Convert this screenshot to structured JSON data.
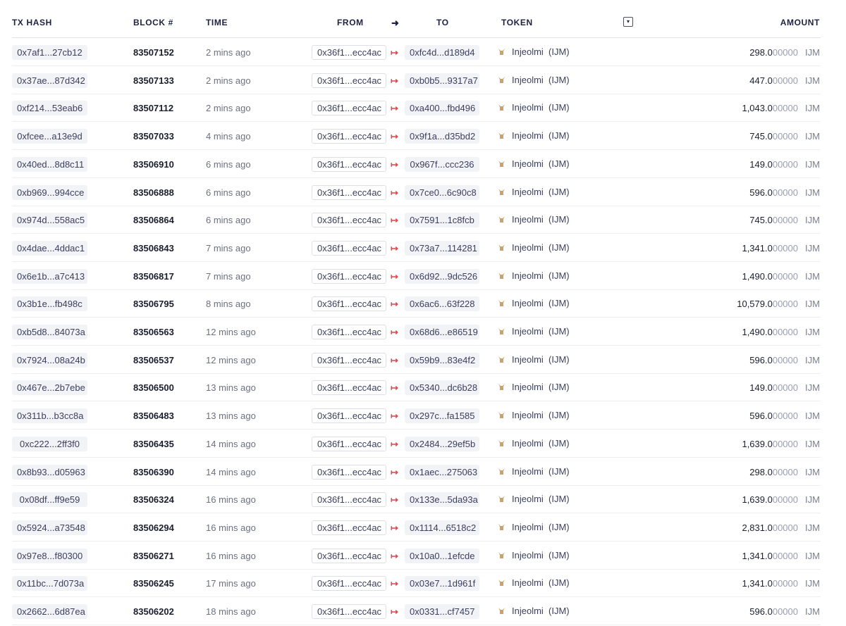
{
  "header": {
    "tx_hash": "TX HASH",
    "block": "BLOCK #",
    "time": "TIME",
    "from": "FROM",
    "arrow": "➜",
    "to": "TO",
    "token": "TOKEN",
    "filter_icon": "▾",
    "amount": "AMOUNT"
  },
  "icons": {
    "direction": "arrow-right-out-icon",
    "token": "injeolmi-token-icon",
    "filter": "filter-dropdown-icon"
  },
  "colors": {
    "direction_arrow": "#e0474c",
    "chip_bg": "#f2f3f7",
    "header_text": "#1e2240"
  },
  "rows": [
    {
      "tx": "0x7af1...27cb12",
      "block": "83507152",
      "time": "2 mins ago",
      "from": "0x36f1...ecc4ac",
      "to": "0xfc4d...d189d4",
      "token": "Injeolmi",
      "symbol": "(IJM)",
      "amount_int": "298.0",
      "amount_dec": "00000",
      "unit": "IJM"
    },
    {
      "tx": "0x37ae...87d342",
      "block": "83507133",
      "time": "2 mins ago",
      "from": "0x36f1...ecc4ac",
      "to": "0xb0b5...9317a7",
      "token": "Injeolmi",
      "symbol": "(IJM)",
      "amount_int": "447.0",
      "amount_dec": "00000",
      "unit": "IJM"
    },
    {
      "tx": "0xf214...53eab6",
      "block": "83507112",
      "time": "2 mins ago",
      "from": "0x36f1...ecc4ac",
      "to": "0xa400...fbd496",
      "token": "Injeolmi",
      "symbol": "(IJM)",
      "amount_int": "1,043.0",
      "amount_dec": "00000",
      "unit": "IJM"
    },
    {
      "tx": "0xfcee...a13e9d",
      "block": "83507033",
      "time": "4 mins ago",
      "from": "0x36f1...ecc4ac",
      "to": "0x9f1a...d35bd2",
      "token": "Injeolmi",
      "symbol": "(IJM)",
      "amount_int": "745.0",
      "amount_dec": "00000",
      "unit": "IJM"
    },
    {
      "tx": "0x40ed...8d8c11",
      "block": "83506910",
      "time": "6 mins ago",
      "from": "0x36f1...ecc4ac",
      "to": "0x967f...ccc236",
      "token": "Injeolmi",
      "symbol": "(IJM)",
      "amount_int": "149.0",
      "amount_dec": "00000",
      "unit": "IJM"
    },
    {
      "tx": "0xb969...994cce",
      "block": "83506888",
      "time": "6 mins ago",
      "from": "0x36f1...ecc4ac",
      "to": "0x7ce0...6c90c8",
      "token": "Injeolmi",
      "symbol": "(IJM)",
      "amount_int": "596.0",
      "amount_dec": "00000",
      "unit": "IJM"
    },
    {
      "tx": "0x974d...558ac5",
      "block": "83506864",
      "time": "6 mins ago",
      "from": "0x36f1...ecc4ac",
      "to": "0x7591...1c8fcb",
      "token": "Injeolmi",
      "symbol": "(IJM)",
      "amount_int": "745.0",
      "amount_dec": "00000",
      "unit": "IJM"
    },
    {
      "tx": "0x4dae...4ddac1",
      "block": "83506843",
      "time": "7 mins ago",
      "from": "0x36f1...ecc4ac",
      "to": "0x73a7...114281",
      "token": "Injeolmi",
      "symbol": "(IJM)",
      "amount_int": "1,341.0",
      "amount_dec": "00000",
      "unit": "IJM"
    },
    {
      "tx": "0x6e1b...a7c413",
      "block": "83506817",
      "time": "7 mins ago",
      "from": "0x36f1...ecc4ac",
      "to": "0x6d92...9dc526",
      "token": "Injeolmi",
      "symbol": "(IJM)",
      "amount_int": "1,490.0",
      "amount_dec": "00000",
      "unit": "IJM"
    },
    {
      "tx": "0x3b1e...fb498c",
      "block": "83506795",
      "time": "8 mins ago",
      "from": "0x36f1...ecc4ac",
      "to": "0x6ac6...63f228",
      "token": "Injeolmi",
      "symbol": "(IJM)",
      "amount_int": "10,579.0",
      "amount_dec": "00000",
      "unit": "IJM"
    },
    {
      "tx": "0xb5d8...84073a",
      "block": "83506563",
      "time": "12 mins ago",
      "from": "0x36f1...ecc4ac",
      "to": "0x68d6...e86519",
      "token": "Injeolmi",
      "symbol": "(IJM)",
      "amount_int": "1,490.0",
      "amount_dec": "00000",
      "unit": "IJM"
    },
    {
      "tx": "0x7924...08a24b",
      "block": "83506537",
      "time": "12 mins ago",
      "from": "0x36f1...ecc4ac",
      "to": "0x59b9...83e4f2",
      "token": "Injeolmi",
      "symbol": "(IJM)",
      "amount_int": "596.0",
      "amount_dec": "00000",
      "unit": "IJM"
    },
    {
      "tx": "0x467e...2b7ebe",
      "block": "83506500",
      "time": "13 mins ago",
      "from": "0x36f1...ecc4ac",
      "to": "0x5340...dc6b28",
      "token": "Injeolmi",
      "symbol": "(IJM)",
      "amount_int": "149.0",
      "amount_dec": "00000",
      "unit": "IJM"
    },
    {
      "tx": "0x311b...b3cc8a",
      "block": "83506483",
      "time": "13 mins ago",
      "from": "0x36f1...ecc4ac",
      "to": "0x297c...fa1585",
      "token": "Injeolmi",
      "symbol": "(IJM)",
      "amount_int": "596.0",
      "amount_dec": "00000",
      "unit": "IJM"
    },
    {
      "tx": "0xc222...2ff3f0",
      "block": "83506435",
      "time": "14 mins ago",
      "from": "0x36f1...ecc4ac",
      "to": "0x2484...29ef5b",
      "token": "Injeolmi",
      "symbol": "(IJM)",
      "amount_int": "1,639.0",
      "amount_dec": "00000",
      "unit": "IJM"
    },
    {
      "tx": "0x8b93...d05963",
      "block": "83506390",
      "time": "14 mins ago",
      "from": "0x36f1...ecc4ac",
      "to": "0x1aec...275063",
      "token": "Injeolmi",
      "symbol": "(IJM)",
      "amount_int": "298.0",
      "amount_dec": "00000",
      "unit": "IJM"
    },
    {
      "tx": "0x08df...ff9e59",
      "block": "83506324",
      "time": "16 mins ago",
      "from": "0x36f1...ecc4ac",
      "to": "0x133e...5da93a",
      "token": "Injeolmi",
      "symbol": "(IJM)",
      "amount_int": "1,639.0",
      "amount_dec": "00000",
      "unit": "IJM"
    },
    {
      "tx": "0x5924...a73548",
      "block": "83506294",
      "time": "16 mins ago",
      "from": "0x36f1...ecc4ac",
      "to": "0x1114...6518c2",
      "token": "Injeolmi",
      "symbol": "(IJM)",
      "amount_int": "2,831.0",
      "amount_dec": "00000",
      "unit": "IJM"
    },
    {
      "tx": "0x97e8...f80300",
      "block": "83506271",
      "time": "16 mins ago",
      "from": "0x36f1...ecc4ac",
      "to": "0x10a0...1efcde",
      "token": "Injeolmi",
      "symbol": "(IJM)",
      "amount_int": "1,341.0",
      "amount_dec": "00000",
      "unit": "IJM"
    },
    {
      "tx": "0x11bc...7d073a",
      "block": "83506245",
      "time": "17 mins ago",
      "from": "0x36f1...ecc4ac",
      "to": "0x03e7...1d961f",
      "token": "Injeolmi",
      "symbol": "(IJM)",
      "amount_int": "1,341.0",
      "amount_dec": "00000",
      "unit": "IJM"
    },
    {
      "tx": "0x2662...6d87ea",
      "block": "83506202",
      "time": "18 mins ago",
      "from": "0x36f1...ecc4ac",
      "to": "0x0331...cf7457",
      "token": "Injeolmi",
      "symbol": "(IJM)",
      "amount_int": "596.0",
      "amount_dec": "00000",
      "unit": "IJM"
    }
  ]
}
